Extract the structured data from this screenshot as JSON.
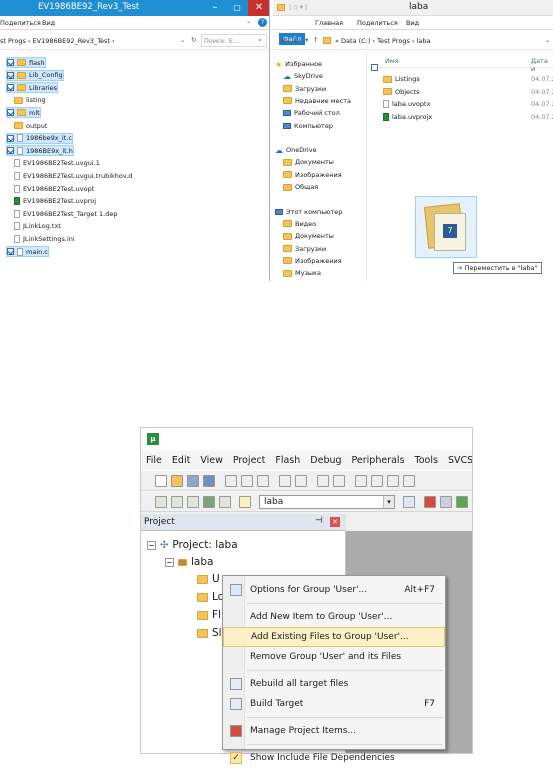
{
  "left_explorer": {
    "title": "EV1986BE92_Rev3_Test",
    "ribbon": [
      "Поделиться",
      "Вид"
    ],
    "breadcrumb": "st Progs  ›  EV1986BE92_Rev3_Test  ›",
    "search_placeholder": "Поиск: E...",
    "items": [
      {
        "name": "flash",
        "kind": "folder",
        "checked": true
      },
      {
        "name": "Lib_Config",
        "kind": "folder",
        "checked": true
      },
      {
        "name": "Libraries",
        "kind": "folder",
        "checked": true
      },
      {
        "name": "listing",
        "kind": "folder",
        "checked": false
      },
      {
        "name": "mlt",
        "kind": "folder",
        "checked": true
      },
      {
        "name": "output",
        "kind": "folder",
        "checked": false
      },
      {
        "name": "1986be9x_it.c",
        "kind": "file",
        "checked": true
      },
      {
        "name": "1986BE9x_it.h",
        "kind": "file",
        "checked": true
      },
      {
        "name": "EV1986BE2Test.uvgui.1",
        "kind": "file",
        "checked": false
      },
      {
        "name": "EV1986BE2Test.uvgui.trubikhov.d",
        "kind": "file",
        "checked": false
      },
      {
        "name": "EV1986BE2Test.uvopt",
        "kind": "file",
        "checked": false
      },
      {
        "name": "EV1986BE2Test.uvproj",
        "kind": "proj",
        "checked": false
      },
      {
        "name": "EV1986BE2Test_Target 1.dep",
        "kind": "file",
        "checked": false
      },
      {
        "name": "JLinkLog.txt",
        "kind": "file",
        "checked": false
      },
      {
        "name": "JLinkSettings.ini",
        "kind": "file",
        "checked": false
      },
      {
        "name": "main.c",
        "kind": "file",
        "checked": true
      }
    ]
  },
  "right_explorer": {
    "title": "laba",
    "tabs": [
      "Файл",
      "Главная",
      "Поделиться",
      "Вид"
    ],
    "breadcrumb": "«  Data (C:)  ›  Test Progs  ›  laba",
    "col_name": "Имя",
    "col_date": "Дата и",
    "nav": [
      {
        "label": "Избранное",
        "icon": "star-icon",
        "indent": 0
      },
      {
        "label": "SkyDrive",
        "icon": "cloud-icon",
        "indent": 1
      },
      {
        "label": "Загрузки",
        "icon": "folder-icon",
        "indent": 1
      },
      {
        "label": "Недавние места",
        "icon": "folder-icon",
        "indent": 1
      },
      {
        "label": "Рабочий стол",
        "icon": "desktop-icon",
        "indent": 1
      },
      {
        "label": "Компьютер",
        "icon": "computer-icon",
        "indent": 1
      },
      {
        "label": "",
        "icon": "",
        "indent": 0
      },
      {
        "label": "OneDrive",
        "icon": "cloud-icon",
        "indent": 0
      },
      {
        "label": "Документы",
        "icon": "folder-icon",
        "indent": 1
      },
      {
        "label": "Изображения",
        "icon": "folder-icon",
        "indent": 1
      },
      {
        "label": "Общая",
        "icon": "folder-icon",
        "indent": 1
      },
      {
        "label": "",
        "icon": "",
        "indent": 0
      },
      {
        "label": "Этот компьютер",
        "icon": "computer-icon",
        "indent": 0
      },
      {
        "label": "Видео",
        "icon": "folder-icon",
        "indent": 1
      },
      {
        "label": "Документы",
        "icon": "folder-icon",
        "indent": 1
      },
      {
        "label": "Загрузки",
        "icon": "folder-icon",
        "indent": 1
      },
      {
        "label": "Изображения",
        "icon": "folder-icon",
        "indent": 1
      },
      {
        "label": "Музыка",
        "icon": "folder-icon",
        "indent": 1
      }
    ],
    "files": [
      {
        "name": "Listings",
        "kind": "folder",
        "date": "04.07.2"
      },
      {
        "name": "Objects",
        "kind": "folder",
        "date": "04.07.2"
      },
      {
        "name": "laba.uvoptx",
        "kind": "file",
        "date": "04.07.2"
      },
      {
        "name": "laba.uvprojx",
        "kind": "proj",
        "date": "04.07.2"
      }
    ],
    "drag_tooltip": "Переместить в \"laba\"",
    "drag_badge": "7"
  },
  "uvision": {
    "menu": [
      "File",
      "Edit",
      "View",
      "Project",
      "Flash",
      "Debug",
      "Peripherals",
      "Tools",
      "SVCS"
    ],
    "target": "laba",
    "panel_title": "Project",
    "tree": {
      "root": "Project: laba",
      "target": "laba",
      "groups": [
        "U",
        "Lo",
        "Fl",
        "Sl"
      ]
    }
  },
  "context_menu": [
    {
      "label": "Options for Group 'User'...",
      "shortcut": "Alt+F7",
      "icon": "options-wand-icon",
      "highlight": false
    },
    {
      "sep": true
    },
    {
      "label": "Add New  Item to Group 'User'...",
      "shortcut": "",
      "icon": "",
      "highlight": false
    },
    {
      "label": "Add Existing Files to Group 'User'...",
      "shortcut": "",
      "icon": "",
      "highlight": true
    },
    {
      "label": "Remove Group 'User' and its Files",
      "shortcut": "",
      "icon": "",
      "highlight": false
    },
    {
      "sep": true
    },
    {
      "label": "Rebuild all target files",
      "shortcut": "",
      "icon": "rebuild-icon",
      "highlight": false
    },
    {
      "label": "Build Target",
      "shortcut": "F7",
      "icon": "build-icon",
      "highlight": false
    },
    {
      "sep": true
    },
    {
      "label": "Manage Project Items...",
      "shortcut": "",
      "icon": "manage-items-icon",
      "highlight": false
    },
    {
      "sep": true
    },
    {
      "label": "Show Include File Dependencies",
      "shortcut": "",
      "icon": "checkmark-icon",
      "highlight": false
    }
  ],
  "colors": {
    "explorer_titlebar": "#1f8fd1",
    "selection": "#cde8ff",
    "highlight": "#fbf0c8",
    "close_red": "#c9302c"
  }
}
